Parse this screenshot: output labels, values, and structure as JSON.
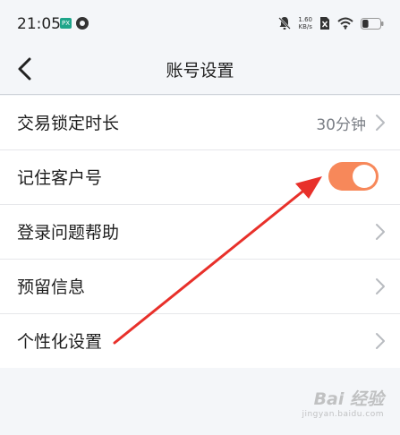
{
  "status_bar": {
    "time": "21:05",
    "app_icon_label": "PX",
    "net_speed_value": "1.60",
    "net_speed_unit": "KB/s",
    "battery_level": 0.35,
    "icons": [
      "app-badge-icon",
      "circle-app-icon",
      "mute-bell-icon",
      "no-sim-icon",
      "wifi-icon",
      "battery-icon"
    ]
  },
  "nav": {
    "title": "账号设置",
    "back_icon": "chevron-left-icon"
  },
  "settings": [
    {
      "label": "交易锁定时长",
      "value": "30分钟",
      "control": "chevron"
    },
    {
      "label": "记住客户号",
      "control": "toggle",
      "on": true
    },
    {
      "label": "登录问题帮助",
      "control": "chevron"
    },
    {
      "label": "预留信息",
      "control": "chevron"
    },
    {
      "label": "个性化设置",
      "control": "chevron"
    }
  ],
  "colors": {
    "toggle_on": "#f7885a",
    "annotation_arrow": "#e8302a",
    "background": "#f4f6f9"
  },
  "watermark": {
    "brand": "Bai 经验",
    "url": "jingyan.baidu.com"
  }
}
